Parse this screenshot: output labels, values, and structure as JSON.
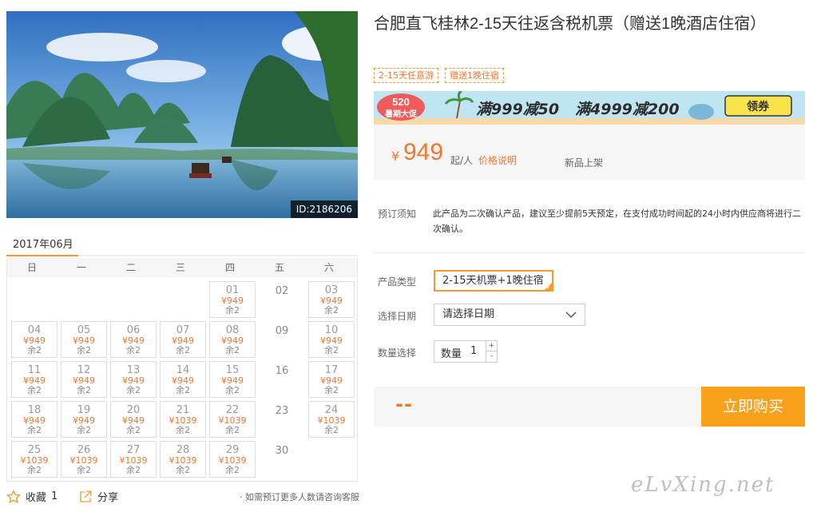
{
  "photo": {
    "id_label": "ID:2186206"
  },
  "calendar": {
    "month": "2017年06月",
    "weekdays": [
      "日",
      "一",
      "二",
      "三",
      "四",
      "五",
      "六"
    ],
    "days": [
      {
        "day": "",
        "price": "",
        "stock": ""
      },
      {
        "day": "",
        "price": "",
        "stock": ""
      },
      {
        "day": "",
        "price": "",
        "stock": ""
      },
      {
        "day": "",
        "price": "",
        "stock": ""
      },
      {
        "day": "01",
        "price": "¥949",
        "stock": "余2"
      },
      {
        "day": "02",
        "price": "",
        "stock": ""
      },
      {
        "day": "03",
        "price": "¥949",
        "stock": "余2"
      },
      {
        "day": "04",
        "price": "¥949",
        "stock": "余2"
      },
      {
        "day": "05",
        "price": "¥949",
        "stock": "余2"
      },
      {
        "day": "06",
        "price": "¥949",
        "stock": "余2"
      },
      {
        "day": "07",
        "price": "¥949",
        "stock": "余2"
      },
      {
        "day": "08",
        "price": "¥949",
        "stock": "余2"
      },
      {
        "day": "09",
        "price": "",
        "stock": ""
      },
      {
        "day": "10",
        "price": "¥949",
        "stock": "余2"
      },
      {
        "day": "11",
        "price": "¥949",
        "stock": "余2"
      },
      {
        "day": "12",
        "price": "¥949",
        "stock": "余2"
      },
      {
        "day": "13",
        "price": "¥949",
        "stock": "余2"
      },
      {
        "day": "14",
        "price": "¥949",
        "stock": "余2"
      },
      {
        "day": "15",
        "price": "¥949",
        "stock": "余2"
      },
      {
        "day": "16",
        "price": "",
        "stock": ""
      },
      {
        "day": "17",
        "price": "¥949",
        "stock": "余2"
      },
      {
        "day": "18",
        "price": "¥949",
        "stock": "余2"
      },
      {
        "day": "19",
        "price": "¥949",
        "stock": "余2"
      },
      {
        "day": "20",
        "price": "¥949",
        "stock": "余2"
      },
      {
        "day": "21",
        "price": "¥1039",
        "stock": "余2"
      },
      {
        "day": "22",
        "price": "¥1039",
        "stock": "余2"
      },
      {
        "day": "23",
        "price": "",
        "stock": ""
      },
      {
        "day": "24",
        "price": "¥1039",
        "stock": "余2"
      },
      {
        "day": "25",
        "price": "¥1039",
        "stock": "余2"
      },
      {
        "day": "26",
        "price": "¥1039",
        "stock": "余2"
      },
      {
        "day": "27",
        "price": "¥1039",
        "stock": "余2"
      },
      {
        "day": "28",
        "price": "¥1039",
        "stock": "余2"
      },
      {
        "day": "29",
        "price": "¥1039",
        "stock": "余2"
      },
      {
        "day": "30",
        "price": "",
        "stock": ""
      }
    ]
  },
  "actions": {
    "favorite_label": "收藏",
    "favorite_count": "1",
    "share_label": "分享",
    "consult_note": "· 如需预订更多人数请咨询客服"
  },
  "product": {
    "title": "合肥直飞桂林2-15天往返含税机票（赠送1晚酒店住宿）",
    "tags": [
      "2-15天任意游",
      "赠送1晚住宿"
    ]
  },
  "banner": {
    "badge_top": "520",
    "badge_bottom": "暑期大促",
    "offer1": "满999减50",
    "offer2": "满4999减200",
    "coupon_button": "领券"
  },
  "price": {
    "currency": "¥",
    "amount": "949",
    "per": "起/人",
    "note_link": "价格说明",
    "new_label": "新品上架"
  },
  "booking": {
    "notice_label": "预订须知",
    "notice_text": "此产品为二次确认产品，建议至少提前5天预定，在支付成功时间起的24小时内供应商将进行二次确认。",
    "type_label": "产品类型",
    "type_value": "2-15天机票+1晚住宿",
    "date_label": "选择日期",
    "date_placeholder": "请选择日期",
    "qty_label": "数量选择",
    "qty_inner_label": "数量",
    "qty_value": "1",
    "qty_plus": "+",
    "qty_minus": "-"
  },
  "buy": {
    "total": "--",
    "button": "立即购买"
  },
  "watermark": "eLvXing.net",
  "colors": {
    "accent": "#f39a2b",
    "price": "#f3762b",
    "buy_button": "#f9a11b"
  }
}
